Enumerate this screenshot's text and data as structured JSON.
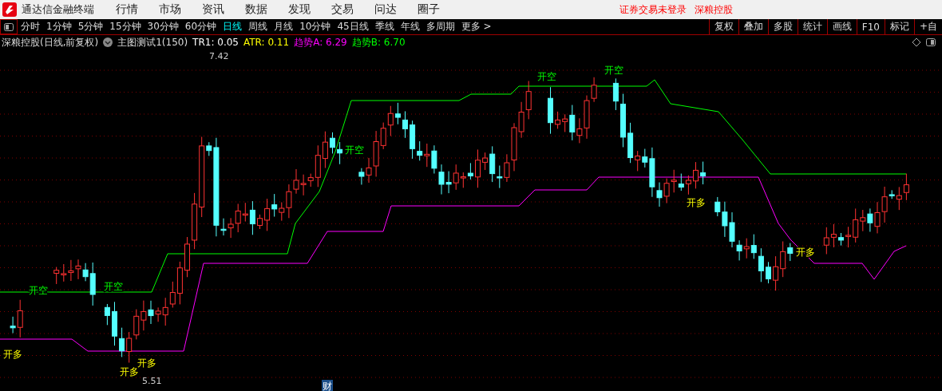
{
  "app": {
    "name": "通达信金融终端"
  },
  "menu": [
    {
      "label": "行情"
    },
    {
      "label": "市场"
    },
    {
      "label": "资讯"
    },
    {
      "label": "数据"
    },
    {
      "label": "发现"
    },
    {
      "label": "交易"
    },
    {
      "label": "问达"
    },
    {
      "label": "圈子"
    }
  ],
  "status": [
    {
      "text": "证券交易未登录"
    },
    {
      "text": "深粮控股"
    }
  ],
  "periods": [
    {
      "label": "分时",
      "selected": false
    },
    {
      "label": "1分钟",
      "selected": false
    },
    {
      "label": "5分钟",
      "selected": false
    },
    {
      "label": "15分钟",
      "selected": false
    },
    {
      "label": "30分钟",
      "selected": false
    },
    {
      "label": "60分钟",
      "selected": false
    },
    {
      "label": "日线",
      "selected": true
    },
    {
      "label": "周线",
      "selected": false
    },
    {
      "label": "月线",
      "selected": false
    },
    {
      "label": "10分钟",
      "selected": false
    },
    {
      "label": "45日线",
      "selected": false
    },
    {
      "label": "季线",
      "selected": false
    },
    {
      "label": "年线",
      "selected": false
    },
    {
      "label": "多周期",
      "selected": false
    },
    {
      "label": "更多 >",
      "selected": false
    }
  ],
  "toolbar": [
    {
      "label": "复权"
    },
    {
      "label": "叠加"
    },
    {
      "label": "多股"
    },
    {
      "label": "统计"
    },
    {
      "label": "画线"
    },
    {
      "label": "F10"
    },
    {
      "label": "标记"
    },
    {
      "label": "+自"
    }
  ],
  "info": {
    "stock": "深粮控股(日线,前复权)",
    "indicator": "主图测试1(150)",
    "values": [
      {
        "text": "TR1: 0.05",
        "color": "#ffffff"
      },
      {
        "text": "ATR: 0.11",
        "color": "#ffff00"
      },
      {
        "text": "趋势A: 6.29",
        "color": "#ff00ff"
      },
      {
        "text": "趋势B: 6.70",
        "color": "#00ff00"
      }
    ]
  },
  "chart": {
    "high_mark": "7.42",
    "low_mark": "5.51",
    "event_badge": "财",
    "signals": [
      {
        "kind": "long",
        "label": "开多"
      },
      {
        "kind": "short",
        "label": "开空"
      },
      {
        "kind": "short",
        "label": "开空"
      },
      {
        "kind": "long",
        "label": "开多"
      },
      {
        "kind": "long",
        "label": "开多"
      },
      {
        "kind": "short",
        "label": "开空"
      },
      {
        "kind": "short",
        "label": "开空"
      },
      {
        "kind": "short",
        "label": "开空"
      },
      {
        "kind": "long",
        "label": "开多"
      },
      {
        "kind": "long",
        "label": "开多"
      }
    ]
  }
}
